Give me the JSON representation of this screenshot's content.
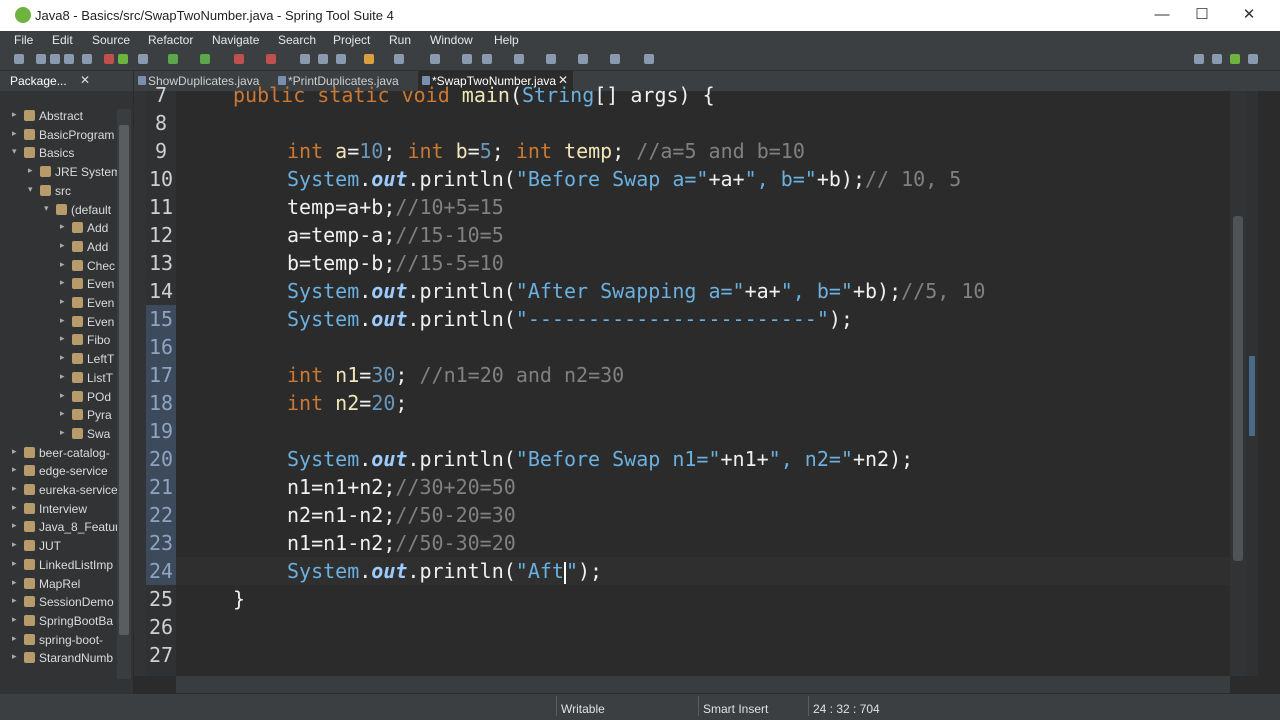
{
  "window": {
    "title": "Java8 - Basics/src/SwapTwoNumber.java - Spring Tool Suite 4",
    "minimize": "—",
    "maximize": "☐",
    "close": "✕"
  },
  "menu": [
    "File",
    "Edit",
    "Source",
    "Refactor",
    "Navigate",
    "Search",
    "Project",
    "Run",
    "Window",
    "Help"
  ],
  "explorer": {
    "tab_label": "Package...",
    "close": "✕",
    "items": [
      {
        "label": "Abstract"
      },
      {
        "label": "BasicProgram"
      },
      {
        "label": "Basics"
      },
      {
        "label": "JRE System"
      },
      {
        "label": "src"
      },
      {
        "label": "(default"
      },
      {
        "label": "Add"
      },
      {
        "label": "Add"
      },
      {
        "label": "Chec"
      },
      {
        "label": "Even"
      },
      {
        "label": "Even"
      },
      {
        "label": "Even"
      },
      {
        "label": "Fibo"
      },
      {
        "label": "LeftT"
      },
      {
        "label": "ListT"
      },
      {
        "label": "POd"
      },
      {
        "label": "Pyra"
      },
      {
        "label": "Swa"
      },
      {
        "label": "beer-catalog-"
      },
      {
        "label": "edge-service"
      },
      {
        "label": "eureka-service"
      },
      {
        "label": "Interview"
      },
      {
        "label": "Java_8_Featur"
      },
      {
        "label": "JUT"
      },
      {
        "label": "LinkedListImp"
      },
      {
        "label": "MapRel"
      },
      {
        "label": "SessionDemo"
      },
      {
        "label": "SpringBootBa"
      },
      {
        "label": "spring-boot-"
      },
      {
        "label": "StarandNumb"
      }
    ]
  },
  "editor_tabs": [
    {
      "label": "ShowDuplicates.java"
    },
    {
      "label": "*PrintDuplicates.java"
    },
    {
      "label": "*SwapTwoNumber.java",
      "close": "✕"
    }
  ],
  "line_numbers": [
    "7",
    "8",
    "9",
    "10",
    "11",
    "12",
    "13",
    "14",
    "15",
    "16",
    "17",
    "18",
    "19",
    "20",
    "21",
    "22",
    "23",
    "24",
    "25",
    "26",
    "27"
  ],
  "code": {
    "l7": {
      "kw": "public static void",
      "name": "main",
      "cls": "String",
      "rest": "[] args) {"
    },
    "l9": {
      "kw1": "int",
      "a1": "a",
      "v1": "10",
      "kw2": "int",
      "b1": "b",
      "v2": "5",
      "kw3": "int",
      "t1": "temp",
      "cm": "//a=5 and b=10"
    },
    "l10": {
      "cls": "System",
      "out": "out",
      "rest1": ".println(",
      "str1": "\"Before Swap a=\"",
      "rest2": "+a+",
      "str2": "\", b=\"",
      "rest3": "+b);",
      "cm": "// 10, 5"
    },
    "l11": {
      "code": "temp=a+b;",
      "cm": "//10+5=15"
    },
    "l12": {
      "code": "a=temp-a;",
      "cm": "//15-10=5"
    },
    "l13": {
      "code": "b=temp-b;",
      "cm": "//15-5=10"
    },
    "l14": {
      "cls": "System",
      "out": "out",
      "rest1": ".println(",
      "str1": "\"After Swapping a=\"",
      "rest2": "+a+",
      "str2": "\", b=\"",
      "rest3": "+b);",
      "cm": "//5, 10"
    },
    "l15": {
      "cls": "System",
      "out": "out",
      "rest1": ".println(",
      "str1": "\"------------------------\"",
      "rest2": ");"
    },
    "l17": {
      "kw": "int",
      "name": "n1",
      "eq": "=",
      "num": "30",
      "semi": ";",
      "cm": "//n1=20 and n2=30"
    },
    "l18": {
      "kw": "int",
      "name": "n2",
      "eq": "=",
      "num": "20",
      "semi": ";"
    },
    "l20": {
      "cls": "System",
      "out": "out",
      "rest1": ".println(",
      "str1": "\"Before Swap n1=\"",
      "rest2": "+n1+",
      "str2": "\", n2=\"",
      "rest3": "+n2);"
    },
    "l21": {
      "code": "n1=n1+n2;",
      "cm": "//30+20=50"
    },
    "l22": {
      "code": "n2=n1-n2;",
      "cm": "//50-20=30"
    },
    "l23": {
      "code": "n1=n1-n2;",
      "cm": "//50-30=20"
    },
    "l24": {
      "cls": "System",
      "out": "out",
      "rest1": ".println(",
      "str1": "\"Aft",
      "str2": "\"",
      "rest2": ");"
    },
    "l25": {
      "code": "}"
    }
  },
  "status": {
    "writable": "Writable",
    "insert_mode": "Smart Insert",
    "position": "24 : 32 : 704"
  },
  "colors": {
    "keyword": "#cc7832",
    "number": "#6897bb",
    "comment": "#808080",
    "string": "#6ab0e0",
    "background": "#2b2b2b"
  }
}
